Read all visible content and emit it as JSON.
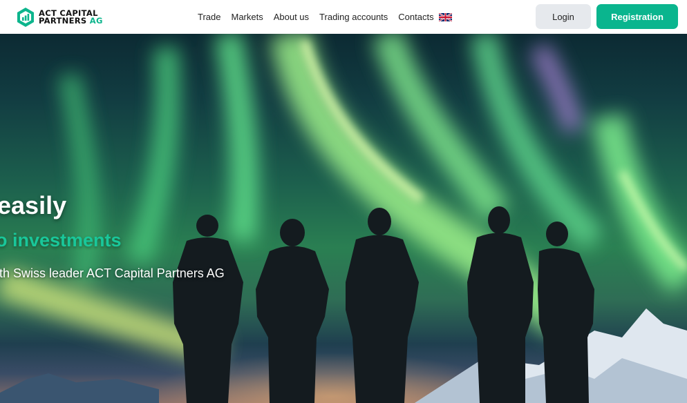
{
  "header": {
    "logo": {
      "line1": "ACT CAPITAL",
      "line2_main": "PARTNERS",
      "line2_accent": "AG"
    },
    "nav": [
      "Trade",
      "Markets",
      "About us",
      "Trading accounts",
      "Contacts"
    ],
    "login_label": "Login",
    "registration_label": "Registration"
  },
  "hero": {
    "title": "easily",
    "subtitle": "o investments",
    "description": "ith Swiss leader ACT Capital Partners AG"
  },
  "colors": {
    "accent": "#0ab58e",
    "login_bg": "#e6e9ed"
  }
}
